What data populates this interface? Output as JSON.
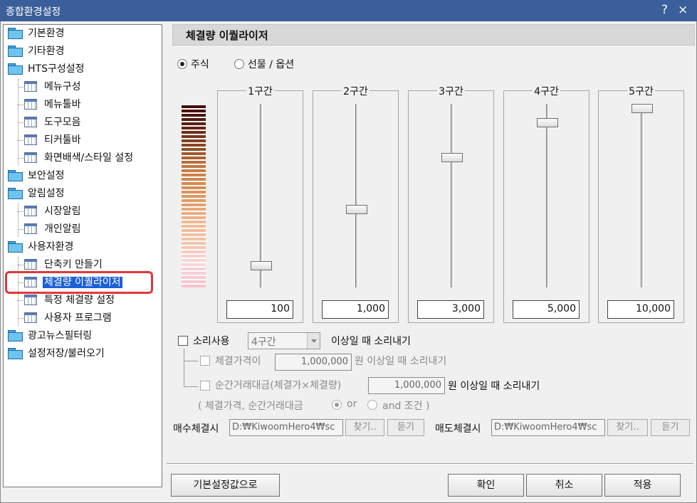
{
  "window": {
    "title": "종합환경설정",
    "help_icon": "?",
    "close_icon": "×"
  },
  "tree": [
    {
      "label": "기본환경",
      "type": "folder"
    },
    {
      "label": "기타환경",
      "type": "folder"
    },
    {
      "label": "HTS구성설정",
      "type": "folder"
    },
    {
      "label": "메뉴구성",
      "type": "page"
    },
    {
      "label": "메뉴툴바",
      "type": "page"
    },
    {
      "label": "도구모음",
      "type": "page"
    },
    {
      "label": "티커툴바",
      "type": "page"
    },
    {
      "label": "화면배색/스타일 설정",
      "type": "page"
    },
    {
      "label": "보안설정",
      "type": "folder"
    },
    {
      "label": "알림설정",
      "type": "folder"
    },
    {
      "label": "시장알림",
      "type": "page"
    },
    {
      "label": "개인알림",
      "type": "page"
    },
    {
      "label": "사용자환경",
      "type": "folder"
    },
    {
      "label": "단축키 만들기",
      "type": "page"
    },
    {
      "label": "체결량 이퀄라이저",
      "type": "page",
      "selected": true
    },
    {
      "label": "특정 체결량 설정",
      "type": "page"
    },
    {
      "label": "사용자 프로그램",
      "type": "page"
    },
    {
      "label": "광고뉴스필터링",
      "type": "folder"
    },
    {
      "label": "설정저장/불러오기",
      "type": "folder"
    }
  ],
  "panel": {
    "title": "체결량 이퀄라이저",
    "market": {
      "stock": "주식",
      "futures": "선물 / 옵션",
      "selected": "stock"
    },
    "sections": [
      {
        "name": "1구간",
        "value": "100",
        "level": 0.1
      },
      {
        "name": "2구간",
        "value": "1,000",
        "level": 0.42
      },
      {
        "name": "3구간",
        "value": "3,000",
        "level": 0.72
      },
      {
        "name": "4구간",
        "value": "5,000",
        "level": 0.92
      },
      {
        "name": "5구간",
        "value": "10,000",
        "level": 1.0
      }
    ],
    "sound": {
      "label": "소리사용",
      "section_value": "4구간",
      "suffix": "이상일 때 소리내기",
      "price_label": "체결가격이",
      "price_value": "1,000,000",
      "price_suffix": "원 이상일 때 소리내기",
      "amount_label": "순간거래대금(체결가×체결량)",
      "amount_value": "1,000,000",
      "amount_suffix": "원 이상일 때 소리내기",
      "cond_prefix": "( 체결가격, 순간거래대금",
      "cond_or": "or",
      "cond_and": "and 조건 )"
    },
    "buy": {
      "label": "매수체결시",
      "path": "D:₩KiwoomHero4₩sc",
      "find": "찾기..",
      "listen": "듣기"
    },
    "sell": {
      "label": "매도체결시",
      "path": "D:₩KiwoomHero4₩sc",
      "find": "찾기..",
      "listen": "듣기"
    }
  },
  "footer": {
    "reset": "기본설정값으로",
    "ok": "확인",
    "cancel": "취소",
    "apply": "적용"
  }
}
